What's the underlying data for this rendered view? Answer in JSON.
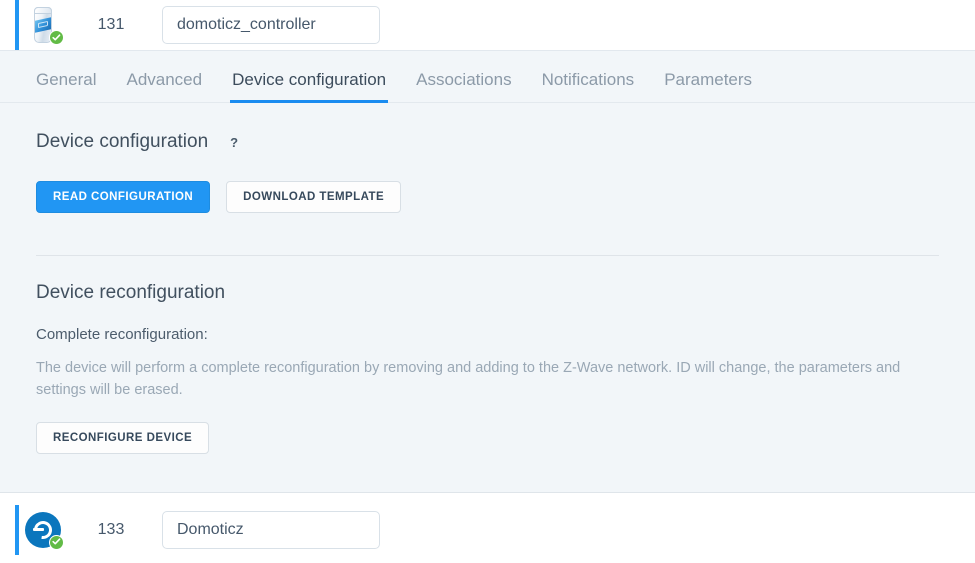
{
  "devices": [
    {
      "id": "131",
      "name": "domoticz_controller",
      "icon": "zwave-controller-icon",
      "status_badge": "check-icon"
    },
    {
      "id": "133",
      "name": "Domoticz",
      "icon": "domoticz-logo-icon",
      "status_badge": "check-icon"
    }
  ],
  "tabs": [
    {
      "label": "General",
      "active": false
    },
    {
      "label": "Advanced",
      "active": false
    },
    {
      "label": "Device configuration",
      "active": true
    },
    {
      "label": "Associations",
      "active": false
    },
    {
      "label": "Notifications",
      "active": false
    },
    {
      "label": "Parameters",
      "active": false
    }
  ],
  "device_configuration": {
    "title": "Device configuration",
    "help_glyph": "?",
    "read_configuration_label": "READ CONFIGURATION",
    "download_template_label": "DOWNLOAD TEMPLATE"
  },
  "device_reconfiguration": {
    "title": "Device reconfiguration",
    "label": "Complete reconfiguration:",
    "description": "The device will perform a complete reconfiguration by removing and adding to the Z-Wave network. ID will change, the parameters and settings will be erased.",
    "reconfigure_label": "RECONFIGURE DEVICE"
  },
  "colors": {
    "accent": "#2196f3",
    "tab_underline": "#1a8cf0",
    "panel_bg": "#f2f6f9",
    "badge_green": "#62bb46",
    "domoticz_blue": "#0b76bd"
  }
}
